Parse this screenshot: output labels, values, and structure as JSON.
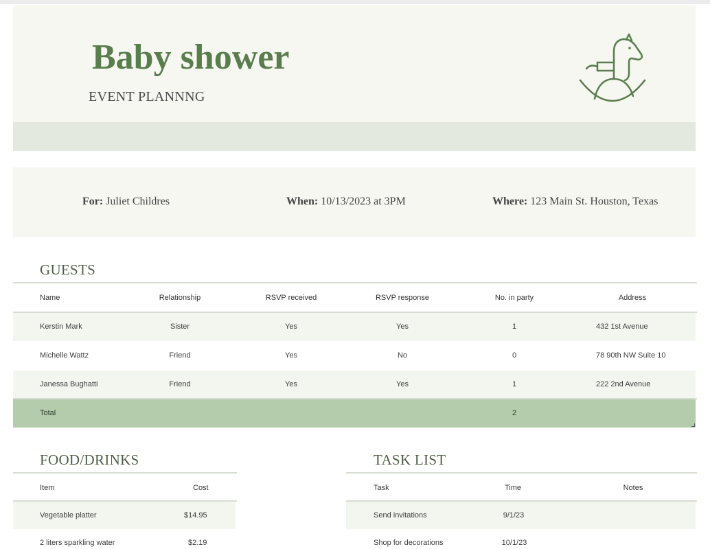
{
  "header": {
    "title": "Baby shower",
    "subtitle": "EVENT PLANNNG",
    "icon": "rocking-horse-icon",
    "accent_color": "#5a7d4e"
  },
  "info": {
    "for_label": "For:",
    "for_value": "Juliet Childres",
    "when_label": "When:",
    "when_value": "10/13/2023 at 3PM",
    "where_label": "Where:",
    "where_value": "123 Main St. Houston, Texas"
  },
  "guests": {
    "title": "GUESTS",
    "columns": [
      "Name",
      "Relationship",
      "RSVP received",
      "RSVP response",
      "No. in party",
      "Address"
    ],
    "rows": [
      [
        "Kerstin Mark",
        "Sister",
        "Yes",
        "Yes",
        "1",
        "432 1st Avenue"
      ],
      [
        "Michelle Wattz",
        "Friend",
        "Yes",
        "No",
        "0",
        "78 90th NW Suite 10"
      ],
      [
        "Janessa Bughatti",
        "Friend",
        "Yes",
        "Yes",
        "1",
        "222 2nd Avenue"
      ]
    ],
    "total_label": "Total",
    "total_value": "2",
    "total_color": "#b4cbac"
  },
  "food": {
    "title": "FOOD/DRINKS",
    "columns": [
      "Item",
      "Cost"
    ],
    "rows": [
      [
        "Vegetable platter",
        "$14.95"
      ],
      [
        "2 liters sparkling water",
        "$2.19"
      ]
    ]
  },
  "tasks": {
    "title": "TASK LIST",
    "columns": [
      "Task",
      "Time",
      "Notes"
    ],
    "rows": [
      [
        "Send invitations",
        "9/1/23",
        ""
      ],
      [
        "Shop for decorations",
        "10/1/23",
        ""
      ]
    ]
  }
}
